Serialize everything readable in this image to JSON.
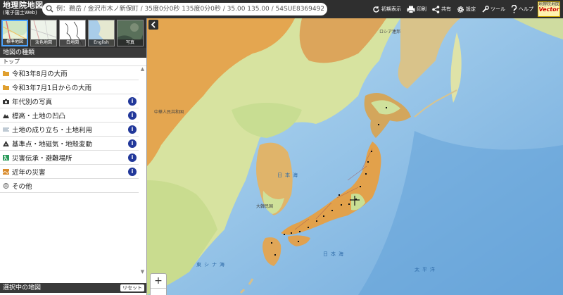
{
  "header": {
    "title_line1": "地理院地図",
    "title_line2": "(電子国土Web)",
    "search_placeholder": "例：鵜岳 / 金沢市木ノ新保町 / 35度0分0秒 135度0分0秒 / 35.00 135.00 / 54SUE83694920",
    "tools": [
      {
        "icon": "reset-view-icon",
        "label": "初期表示"
      },
      {
        "icon": "print-icon",
        "label": "印刷"
      },
      {
        "icon": "share-icon",
        "label": "共有"
      },
      {
        "icon": "gear-icon",
        "label": "設定"
      },
      {
        "icon": "tools-icon",
        "label": "ツール"
      },
      {
        "icon": "help-icon",
        "label": "ヘルプ"
      }
    ],
    "logo_line1": "地理院地図",
    "logo_line2": "Vector"
  },
  "sidebar": {
    "thumbnails": [
      {
        "label": "標準地図",
        "selected": true
      },
      {
        "label": "淡色地図",
        "selected": false
      },
      {
        "label": "白地図",
        "selected": false
      },
      {
        "label": "English",
        "selected": false
      },
      {
        "label": "写真",
        "selected": false
      }
    ],
    "section_title": "地図の種類",
    "breadcrumb": "トップ",
    "items": [
      {
        "label": "令和3年8月の大雨",
        "icon": "folder-icon",
        "info": false
      },
      {
        "label": "令和3年7月1日からの大雨",
        "icon": "folder-icon",
        "info": false
      },
      {
        "label": "年代別の写真",
        "icon": "camera-icon",
        "info": true
      },
      {
        "label": "標高・土地の凹凸",
        "icon": "mountain-icon",
        "info": true
      },
      {
        "label": "土地の成り立ち・土地利用",
        "icon": "layers-icon",
        "info": true
      },
      {
        "label": "基準点・地磁気・地殻変動",
        "icon": "survey-point-icon",
        "info": true
      },
      {
        "label": "災害伝承・避難場所",
        "icon": "evacuation-icon",
        "info": true
      },
      {
        "label": "近年の災害",
        "icon": "disaster-icon",
        "info": true
      },
      {
        "label": "その他",
        "icon": "globe-icon",
        "info": false
      }
    ],
    "info_glyph": "i",
    "selected_title": "選択中の地図",
    "reset_label": "リセット"
  },
  "map": {
    "sea_labels": [
      "日本海",
      "日本海",
      "太平洋",
      "東シナ海"
    ],
    "place_labels": [
      "中華人民共和国",
      "ロシア連邦",
      "大韓民国"
    ],
    "zoom_in": "+",
    "zoom_out": "−"
  },
  "colors": {
    "header_bg": "#2f2f2f",
    "sea": "#b5d8f0",
    "deep_sea": "#7fb6e3",
    "lowland": "#d7e6a8",
    "highland": "#e3a04c",
    "info_badge": "#22389a"
  }
}
